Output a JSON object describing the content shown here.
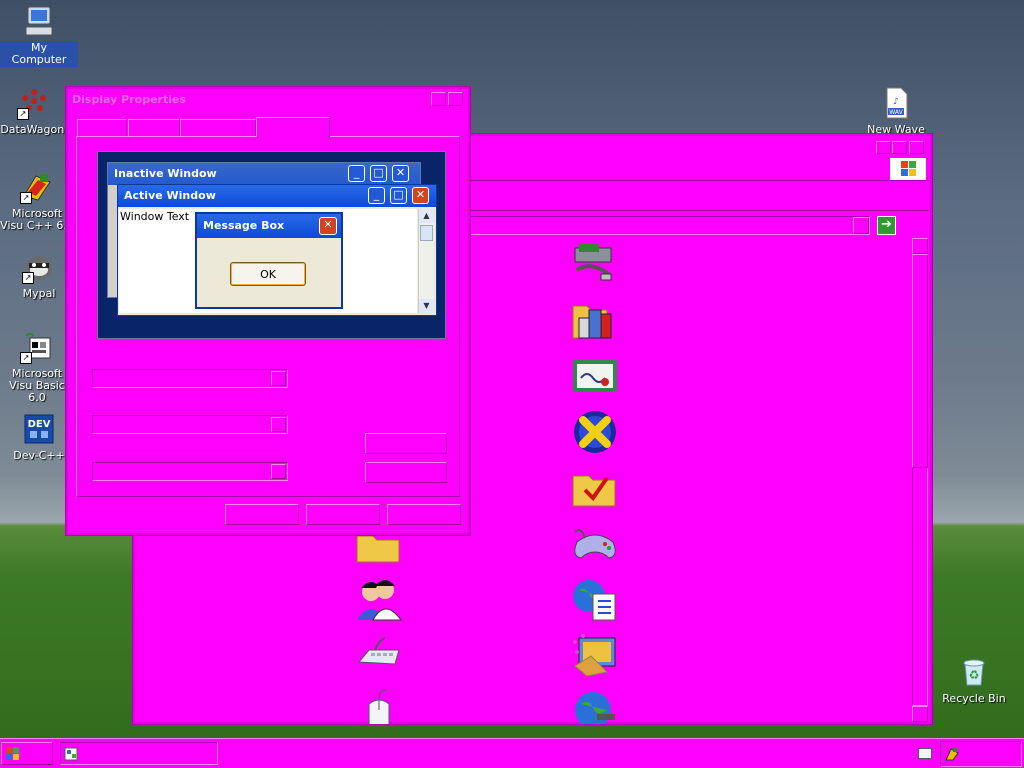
{
  "desktop": {
    "icons": [
      {
        "label": "My Computer",
        "icon": "my-computer-icon",
        "selected": true
      },
      {
        "label": "DataWagon.",
        "icon": "datawagon-icon"
      },
      {
        "label": "Microsoft Visu C++ 6.0",
        "icon": "visual-cpp-icon"
      },
      {
        "label": "Mypal",
        "icon": "mypal-icon"
      },
      {
        "label": "Microsoft Visu Basic 6.0",
        "icon": "visual-basic-icon"
      },
      {
        "label": "Dev-C++",
        "icon": "dev-cpp-icon"
      },
      {
        "label": "New Wave",
        "icon": "wav-file-icon"
      },
      {
        "label": "Recycle Bin",
        "icon": "recycle-bin-icon"
      }
    ]
  },
  "display_properties": {
    "title": "Display Properties",
    "preview": {
      "inactive_title": "Inactive Window",
      "active_title": "Active Window",
      "window_text": "Window Text",
      "message_title": "Message Box",
      "ok_label": "OK"
    }
  },
  "control_panel": {
    "icons": [
      "add-hardware-icon",
      "admin-tools-icon",
      "certificate-icon",
      "directx-icon",
      "folder-options-icon",
      "game-controllers-icon",
      "internet-options-icon",
      "display-icon",
      "network-icon",
      "folder-icon",
      "users-icon",
      "keyboard-icon",
      "mouse-icon"
    ]
  },
  "colors": {
    "theme": "#ff00ff",
    "xp_blue": "#0a246a",
    "close_red": "#d2431e"
  }
}
